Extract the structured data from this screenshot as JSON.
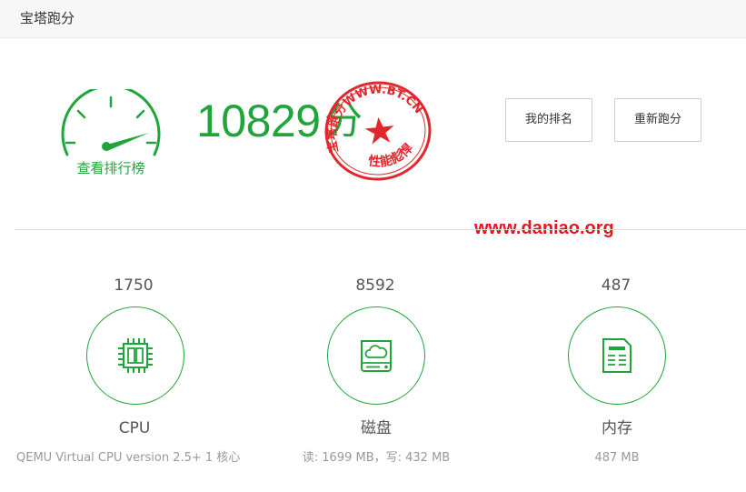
{
  "window": {
    "title": "宝塔跑分"
  },
  "summary": {
    "gauge_label": "查看排行榜",
    "total_score": "10829",
    "score_unit": "分",
    "stamp_text_top": "宝塔跑分WWW.BT.CN",
    "stamp_text_bottom": "性能彪悍"
  },
  "actions": {
    "my_rank": "我的排名",
    "rerun": "重新跑分"
  },
  "watermark": "www.daniao.org",
  "metrics": {
    "cpu": {
      "score": "1750",
      "name": "CPU",
      "desc": "QEMU Virtual CPU version 2.5+ 1 核心"
    },
    "disk": {
      "score": "8592",
      "name": "磁盘",
      "desc": "读: 1699 MB，写: 432 MB"
    },
    "memory": {
      "score": "487",
      "name": "内存",
      "desc": "487 MB"
    }
  },
  "colors": {
    "accent": "#20a53a",
    "stamp": "#e3262b",
    "watermark": "#e8141a"
  }
}
